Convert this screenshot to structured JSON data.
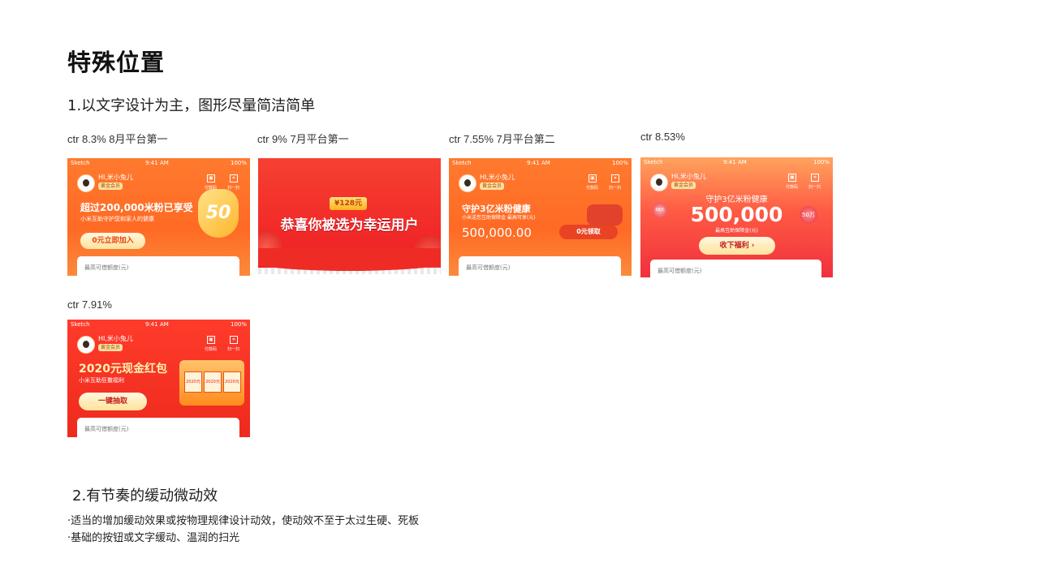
{
  "page": {
    "title": "特殊位置",
    "section1": "1.以文字设计为主，图形尽量简洁简单",
    "section2": "2.有节奏的缓动微动效",
    "bullets": [
      "·适当的增加缓动效果或按物理规律设计动效，使动效不至于太过生硬、死板",
      "·基础的按钮或文字缓动、温润的扫光"
    ]
  },
  "status": {
    "carrier": "Sketch",
    "time": "9:41 AM",
    "battery": "100%"
  },
  "header": {
    "greeting": "HI,米小兔儿",
    "vip": "黄金会员",
    "pay": "付款码",
    "scan": "扫一扫"
  },
  "panel": {
    "label": "最高可借额度(元)"
  },
  "cards": [
    {
      "caption": "ctr 8.3% 8月平台第一",
      "headline": "超过200,000米粉已享受",
      "sub": "小米互助守护您和家人的健康",
      "cta": "0元立即加入",
      "badge": "50"
    },
    {
      "caption": "ctr 9% 7月平台第一",
      "badge": "¥128元",
      "headline": "恭喜你被选为幸运用户"
    },
    {
      "caption": "ctr 7.55% 7月平台第二",
      "headline": "守护3亿米粉健康",
      "sub": "小米送您互助保障金 最高可享(元)",
      "amount": "500,000.00",
      "cta": "0元领取"
    },
    {
      "caption": "ctr 8.53%",
      "headline": "守护3亿米粉健康",
      "amount": "500,000",
      "sub": "最高互助保障金(元)",
      "cta": "收下福利 ›",
      "tag_left": "88元",
      "tag_right": "50万"
    },
    {
      "caption": "ctr 7.91%",
      "headline": "2020元现金红包",
      "sub": "小米互助狂撒福利",
      "cta": "一键抽取",
      "slots": [
        "2020元",
        "2020元",
        "2020元"
      ]
    }
  ],
  "colors": {
    "orange": "#ff6a24",
    "red": "#ee1d23",
    "cta_text": "#e8420f"
  }
}
